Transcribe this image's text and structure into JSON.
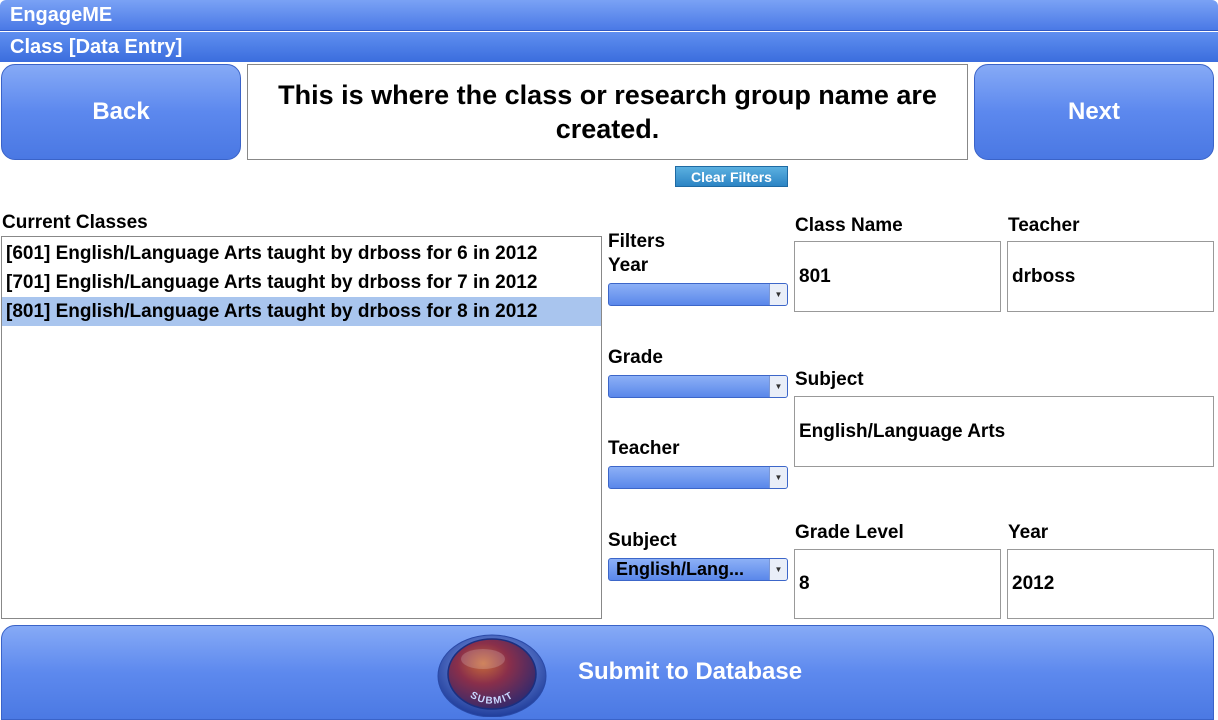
{
  "app": {
    "title": "EngageME"
  },
  "page": {
    "title": "Class [Data Entry]"
  },
  "nav": {
    "back_label": "Back",
    "next_label": "Next"
  },
  "info": {
    "message": "This is where the class or research group name are created."
  },
  "filters": {
    "clear_label": "Clear Filters",
    "heading": "Filters",
    "year_label": "Year",
    "year_value": "",
    "grade_label": "Grade",
    "grade_value": "",
    "teacher_label": "Teacher",
    "teacher_value": "",
    "subject_label": "Subject",
    "subject_value": "English/Lang..."
  },
  "current_classes": {
    "label": "Current Classes",
    "items": [
      "[601] English/Language Arts taught by drboss for 6 in 2012",
      "[701] English/Language Arts taught by drboss for 7 in 2012",
      "[801] English/Language Arts taught by drboss for 8 in 2012"
    ],
    "selected_index": 2
  },
  "form": {
    "class_name_label": "Class Name",
    "class_name_value": "801",
    "teacher_label": "Teacher",
    "teacher_value": "drboss",
    "subject_label": "Subject",
    "subject_value": "English/Language Arts",
    "grade_level_label": "Grade Level",
    "grade_level_value": "8",
    "year_label": "Year",
    "year_value": "2012"
  },
  "submit": {
    "label": "Submit to Database",
    "icon_text": "SUBMIT",
    "icon": "submit-orb-icon"
  },
  "colors": {
    "accent": "#4a79e6",
    "selected_row": "#a9c5ee",
    "clear_button": "#2c84c4"
  }
}
